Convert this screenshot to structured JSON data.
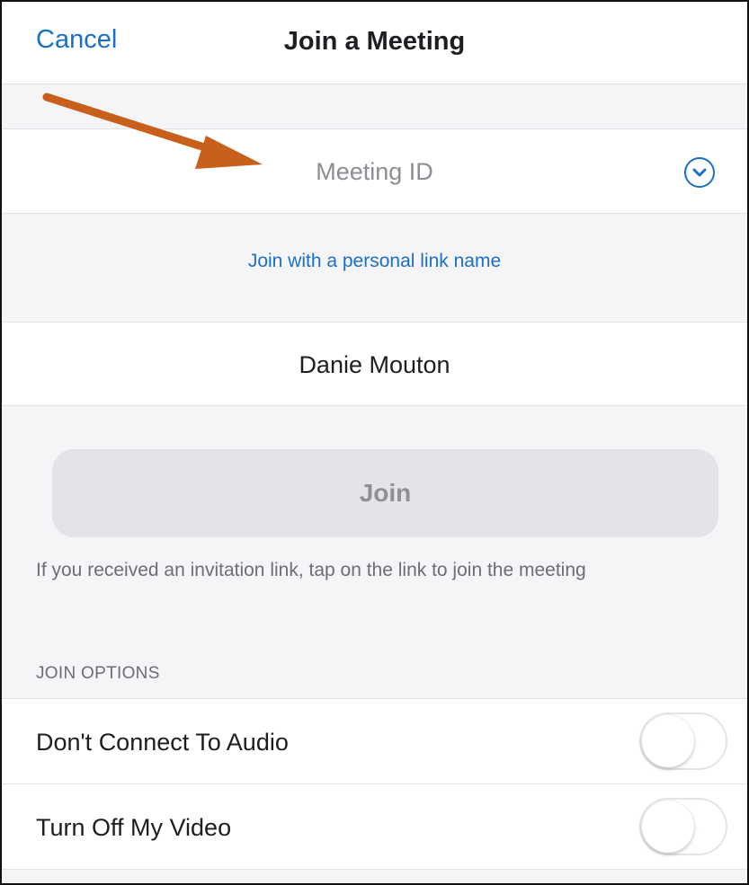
{
  "navbar": {
    "cancel_label": "Cancel",
    "title": "Join a Meeting"
  },
  "meeting_id": {
    "placeholder": "Meeting ID",
    "value": "",
    "dropdown_icon": "chevron-down-circle-icon"
  },
  "personal_link_label": "Join with a personal link name",
  "name_field": {
    "value": "Danie Mouton"
  },
  "join_button_label": "Join",
  "invitation_hint": "If you received an invitation link, tap on the link to join the meeting",
  "join_options": {
    "header": "JOIN OPTIONS",
    "items": [
      {
        "label": "Don't Connect To Audio",
        "enabled": false
      },
      {
        "label": "Turn Off My Video",
        "enabled": false
      }
    ]
  },
  "annotation": {
    "icon": "arrow-icon",
    "color": "#c8601c"
  },
  "colors": {
    "accent": "#1a6fc8",
    "background": "#f5f5f7",
    "join_button_bg": "#e3e3e8",
    "join_button_text": "#8f8f96"
  }
}
